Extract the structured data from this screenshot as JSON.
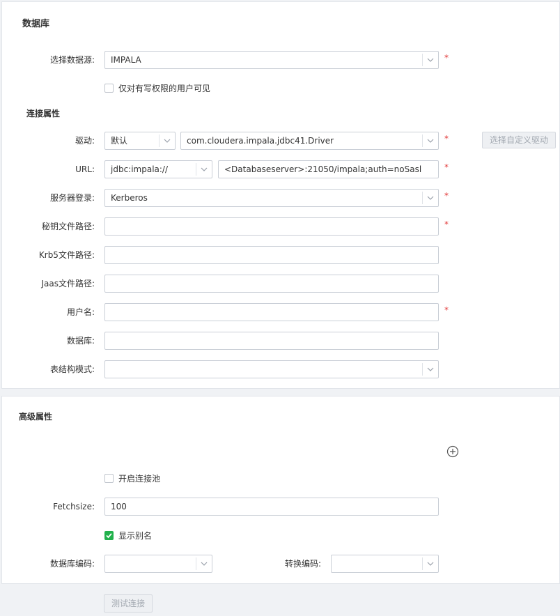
{
  "database_section": {
    "title": "数据库",
    "datasource": {
      "label": "选择数据源:",
      "value": "IMPALA"
    },
    "write_permission_checkbox": {
      "label": "仅对有写权限的用户可见",
      "checked": false
    }
  },
  "connection_section": {
    "title": "连接属性",
    "driver": {
      "label": "驱动:",
      "type_value": "默认",
      "class_value": "com.cloudera.impala.jdbc41.Driver",
      "custom_button": "选择自定义驱动"
    },
    "url": {
      "label": "URL:",
      "prefix_value": "jdbc:impala://",
      "value": "<Databaseserver>:21050/impala;auth=noSasl"
    },
    "server_login": {
      "label": "服务器登录:",
      "value": "Kerberos"
    },
    "keytab_path": {
      "label": "秘钥文件路径:",
      "value": ""
    },
    "krb5_path": {
      "label": "Krb5文件路径:",
      "value": ""
    },
    "jaas_path": {
      "label": "Jaas文件路径:",
      "value": ""
    },
    "username": {
      "label": "用户名:",
      "value": ""
    },
    "database": {
      "label": "数据库:",
      "value": ""
    },
    "schema": {
      "label": "表结构模式:",
      "value": ""
    },
    "required_mark": "*"
  },
  "advanced_section": {
    "title": "高级属性",
    "pool_checkbox": {
      "label": "开启连接池",
      "checked": false
    },
    "fetchsize": {
      "label": "Fetchsize:",
      "value": "100"
    },
    "alias_checkbox": {
      "label": "显示别名",
      "checked": true
    },
    "db_encoding": {
      "label": "数据库编码:",
      "value": ""
    },
    "convert_encoding": {
      "label": "转换编码:",
      "value": ""
    }
  },
  "test_button": {
    "label": "测试连接"
  },
  "colors": {
    "required": "#e23a3a",
    "checked": "#22b14c",
    "border": "#c9ced6"
  }
}
